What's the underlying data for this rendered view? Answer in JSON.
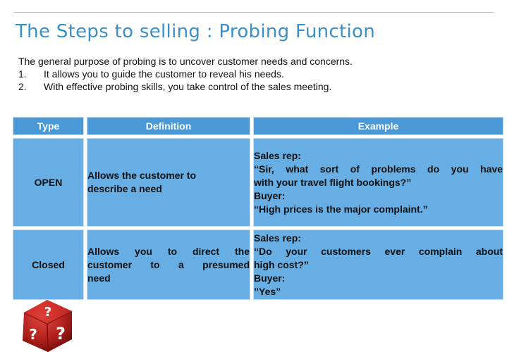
{
  "slide": {
    "title": "The Steps to selling : Probing Function",
    "intro": "The general purpose of probing is to uncover customer needs and concerns.",
    "points": [
      {
        "num": "1.",
        "text": "It allows you to guide the customer to reveal his needs."
      },
      {
        "num": "2.",
        "text": "With effective probing skills, you take control of the sales meeting."
      }
    ]
  },
  "table": {
    "headers": [
      "Type",
      "Definition",
      "Example"
    ],
    "rows": [
      {
        "type": "OPEN",
        "definition_lines": [
          "Allows the customer to",
          "describe a need"
        ],
        "example_lines": [
          "Sales rep:",
          "“Sir, what sort of problems do you have",
          "with your travel flight bookings?”",
          "Buyer:",
          "“High prices is the major complaint.”"
        ]
      },
      {
        "type": "Closed",
        "definition_lines": [
          "Allows you to direct the",
          "customer to a presumed",
          "need"
        ],
        "example_lines": [
          "Sales rep:",
          "“Do your customers ever complain about",
          "high cost?”",
          "Buyer:",
          "”Yes”"
        ]
      }
    ]
  },
  "colors": {
    "title": "#3b8fc9",
    "header_fill": "#4a99d6",
    "cell_fill": "#66aee3",
    "dice": "#b3201c"
  },
  "graphic": {
    "icon": "question-dice-icon",
    "glyph": "?"
  }
}
